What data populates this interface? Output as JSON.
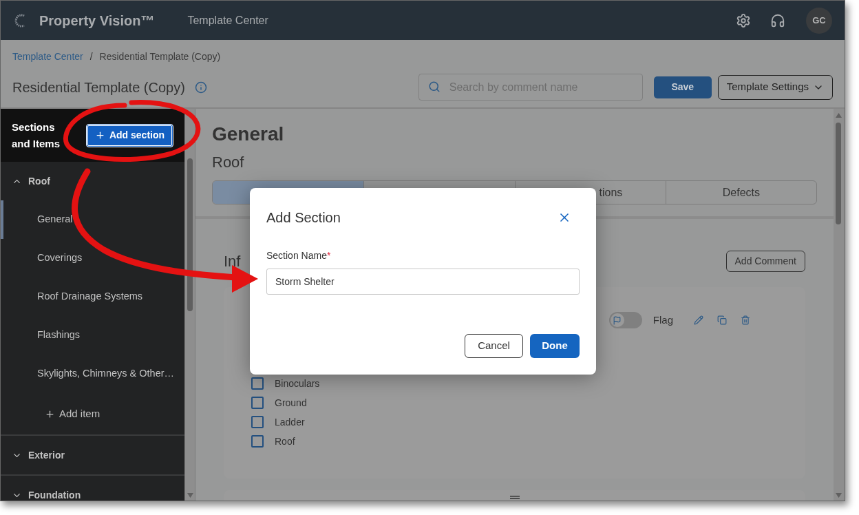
{
  "app": {
    "name": "Property Vision™",
    "nav_title": "Template Center",
    "avatar": "GC"
  },
  "breadcrumb": [
    {
      "label": "Template Center",
      "kind": "link"
    },
    {
      "label": "Residential Template (Copy)",
      "kind": "current"
    }
  ],
  "breadcrumb_separator": "/",
  "page_title": "Residential Template (Copy)",
  "search": {
    "placeholder": "Search by comment name"
  },
  "buttons": {
    "save": "Save",
    "settings": "Template Settings"
  },
  "sidebar": {
    "title": "Sections and Items",
    "add_section": "Add section",
    "sections": [
      {
        "label": "Roof",
        "expanded": true,
        "add_item": "Add item",
        "children": [
          {
            "label": "General",
            "selected": true
          },
          {
            "label": "Coverings",
            "selected": false
          },
          {
            "label": "Roof Drainage Systems",
            "selected": false
          },
          {
            "label": "Flashings",
            "selected": false
          },
          {
            "label": "Skylights, Chimneys & Other…",
            "selected": false
          }
        ]
      },
      {
        "label": "Exterior",
        "expanded": false
      },
      {
        "label": "Foundation",
        "expanded": false
      }
    ]
  },
  "content": {
    "section_title": "General",
    "item_title": "Roof",
    "tabs": [
      {
        "selected": true
      },
      {
        "selected": false
      },
      {
        "label": "tions",
        "selected": false
      },
      {
        "label": "Defects",
        "selected": false
      }
    ],
    "heading": "Inf",
    "add_comment": "Add Comment",
    "comment": {
      "flag_label": "Flag",
      "flagged": false,
      "options": [
        {
          "label": "Binoculars",
          "checked": false
        },
        {
          "label": "Ground",
          "checked": false
        },
        {
          "label": "Ladder",
          "checked": false
        },
        {
          "label": "Roof",
          "checked": false
        }
      ]
    }
  },
  "dialog": {
    "title": "Add Section",
    "field_label": "Section Name",
    "required_mark": "*",
    "value": "Storm Shelter",
    "buttons": [
      {
        "label": "Cancel",
        "kind": "secondary"
      },
      {
        "label": "Done",
        "kind": "primary"
      }
    ]
  }
}
